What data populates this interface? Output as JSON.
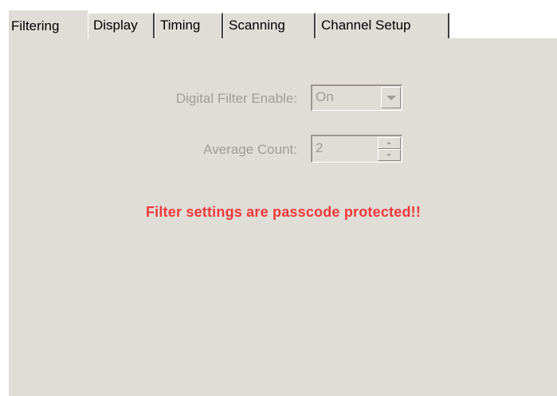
{
  "tabs": [
    {
      "label": "Filtering",
      "active": true
    },
    {
      "label": "Display",
      "active": false
    },
    {
      "label": "Timing",
      "active": false
    },
    {
      "label": "Scanning",
      "active": false
    },
    {
      "label": "Channel Setup",
      "active": false
    }
  ],
  "filter": {
    "enable_label": "Digital Filter Enable:",
    "enable_value": "On",
    "average_label": "Average Count:",
    "average_value": "2",
    "disabled": true
  },
  "warning": {
    "text": "Filter settings are passcode protected!!"
  },
  "colors": {
    "panel_bg": "#e0dcd6",
    "disabled_text": "#a09d98",
    "warning": "#ef3a3c"
  },
  "icons": {
    "combo_arrow": "chevron-down-icon",
    "spin_up": "arrow-up-icon",
    "spin_down": "arrow-down-icon"
  }
}
